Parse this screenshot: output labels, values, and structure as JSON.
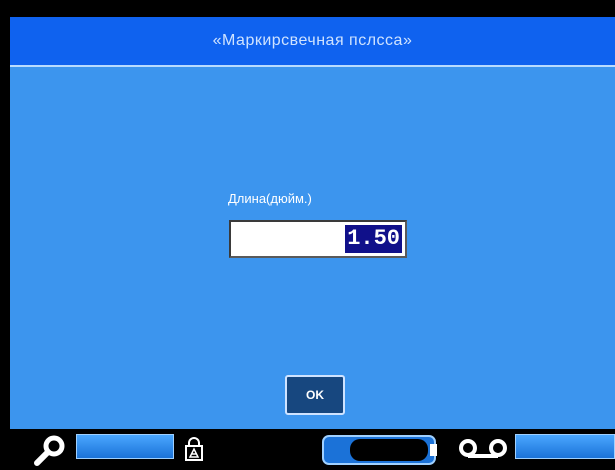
{
  "header": {
    "title": "«Маркирсвечная пслсса»"
  },
  "form": {
    "label": "Длина(дюйм.)",
    "value": "1.50"
  },
  "buttons": {
    "ok_label": "OK"
  },
  "status_bar": {
    "icons": [
      "search-icon",
      "lock-icon",
      "tape-cartridge-icon",
      "tape-reel-icon"
    ]
  },
  "colors": {
    "title_bg": "#0f62ef",
    "dialog_bg": "#3c95ee",
    "button_bg": "#17477f",
    "selection_bg": "#10108a"
  }
}
